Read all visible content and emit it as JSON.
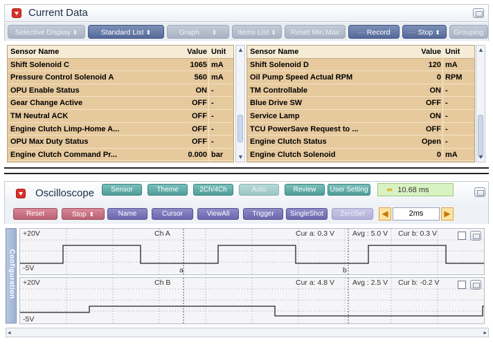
{
  "current_data": {
    "title": "Current Data",
    "toolbar": [
      {
        "label": "Selective Display",
        "state": "disabled",
        "has_arrow": true
      },
      {
        "label": "Standard List",
        "state": "active",
        "has_arrow": true
      },
      {
        "label": "Graph",
        "state": "disabled",
        "has_arrow": true
      },
      {
        "label": "Items List",
        "state": "disabled",
        "has_arrow": true
      },
      {
        "label": "Reset Min.Max",
        "state": "disabled",
        "has_arrow": false
      },
      {
        "label": "Record",
        "state": "active",
        "has_arrow": false
      },
      {
        "label": "Stop",
        "state": "active",
        "has_arrow": true
      },
      {
        "label": "Grouping",
        "state": "disabled",
        "has_arrow": false
      }
    ],
    "columns": {
      "name": "Sensor Name",
      "value": "Value",
      "unit": "Unit"
    },
    "left_table": [
      {
        "name": "Shift Solenoid C",
        "value": "1065",
        "unit": "mA"
      },
      {
        "name": "Pressure Control Solenoid A",
        "value": "560",
        "unit": "mA"
      },
      {
        "name": "OPU Enable Status",
        "value": "ON",
        "unit": "-"
      },
      {
        "name": "Gear Change Active",
        "value": "OFF",
        "unit": "-"
      },
      {
        "name": "TM Neutral ACK",
        "value": "OFF",
        "unit": "-"
      },
      {
        "name": "Engine Clutch Limp-Home A...",
        "value": "OFF",
        "unit": "-"
      },
      {
        "name": "OPU Max Duty Status",
        "value": "OFF",
        "unit": "-"
      },
      {
        "name": "Engine Clutch Command Pr...",
        "value": "0.000",
        "unit": "bar"
      }
    ],
    "right_table": [
      {
        "name": "Shift Solenoid D",
        "value": "120",
        "unit": "mA"
      },
      {
        "name": "Oil Pump Speed Actual RPM",
        "value": "0",
        "unit": "RPM"
      },
      {
        "name": "TM Controllable",
        "value": "ON",
        "unit": "-"
      },
      {
        "name": "Blue Drive SW",
        "value": "OFF",
        "unit": "-"
      },
      {
        "name": "Service Lamp",
        "value": "ON",
        "unit": "-"
      },
      {
        "name": "TCU PowerSave Request to ...",
        "value": "OFF",
        "unit": "-"
      },
      {
        "name": "Engine Clutch Status",
        "value": "Open",
        "unit": "-"
      },
      {
        "name": "Engine Clutch Solenoid",
        "value": "0",
        "unit": "mA"
      }
    ]
  },
  "oscilloscope": {
    "title": "Oscilloscope",
    "row1_buttons": [
      {
        "label": "Sensor",
        "style": "teal"
      },
      {
        "label": "Theme",
        "style": "teal"
      },
      {
        "label": "2Ch/4Ch",
        "style": "teal"
      },
      {
        "label": "Auto",
        "style": "teal-dis"
      },
      {
        "label": "Review",
        "style": "teal"
      },
      {
        "label": "User Setting",
        "style": "teal"
      }
    ],
    "time_readout": "10.68 ms",
    "row2_buttons": [
      {
        "label": "Reset",
        "style": "pink"
      },
      {
        "label": "Stop",
        "style": "pink",
        "has_arrow": true
      },
      {
        "label": "Name",
        "style": "purple"
      },
      {
        "label": "Cursor",
        "style": "purple"
      },
      {
        "label": "ViewAll",
        "style": "purple"
      },
      {
        "label": "Trigger",
        "style": "purple"
      },
      {
        "label": "SingleShot",
        "style": "purple"
      },
      {
        "label": "ZeroSet",
        "style": "purple-dis"
      }
    ],
    "time_div": "2ms",
    "side_tab": "Configuration",
    "channels": [
      {
        "name": "Ch A",
        "top_label": "+20V",
        "bottom_label": "-5V",
        "cursor_a": "Cur a: 0.3 V",
        "avg": "Avg : 5.0 V",
        "cursor_b": "Cur b: 0.3 V",
        "cursor_a_marker": "a",
        "cursor_b_marker": "b"
      },
      {
        "name": "Ch B",
        "top_label": "+20V",
        "bottom_label": "-5V",
        "cursor_a": "Cur a: 4.8 V",
        "avg": "Avg : 2.5 V",
        "cursor_b": "Cur b: -0.2 V"
      }
    ]
  },
  "colors": {
    "table_bg": "#e6c99d",
    "accent_blue": "#556a99",
    "trace": "#222222"
  }
}
